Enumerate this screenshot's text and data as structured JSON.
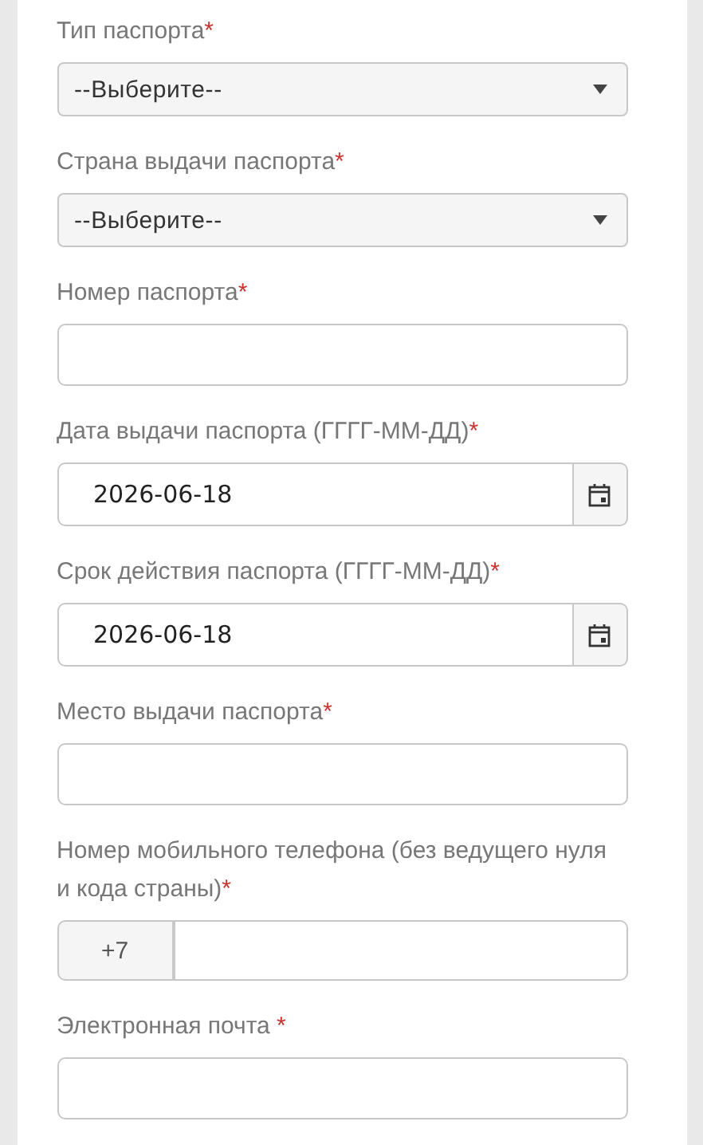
{
  "fields": [
    {
      "kind": "select",
      "label": "Тип паспорта",
      "required_mark": "*",
      "value": "--Выберите--"
    },
    {
      "kind": "select",
      "label": "Страна выдачи паспорта",
      "required_mark": "*",
      "value": "--Выберите--"
    },
    {
      "kind": "text",
      "label": "Номер паспорта",
      "required_mark": "*"
    },
    {
      "kind": "date",
      "label": "Дата выдачи паспорта (ГГГГ-ММ-ДД)",
      "required_mark": "*",
      "value": "2026-06-18"
    },
    {
      "kind": "date",
      "label": "Срок действия паспорта (ГГГГ-ММ-ДД)",
      "required_mark": "*",
      "value": "2026-06-18"
    },
    {
      "kind": "text",
      "label": "Место выдачи паспорта",
      "required_mark": "*"
    },
    {
      "kind": "phone",
      "label": "Номер мобильного телефона (без ведущего нуля и кода страны)",
      "required_mark": "*",
      "prefix": "+7"
    },
    {
      "kind": "text",
      "label": "Электронная почта",
      "required_mark": " *"
    }
  ]
}
